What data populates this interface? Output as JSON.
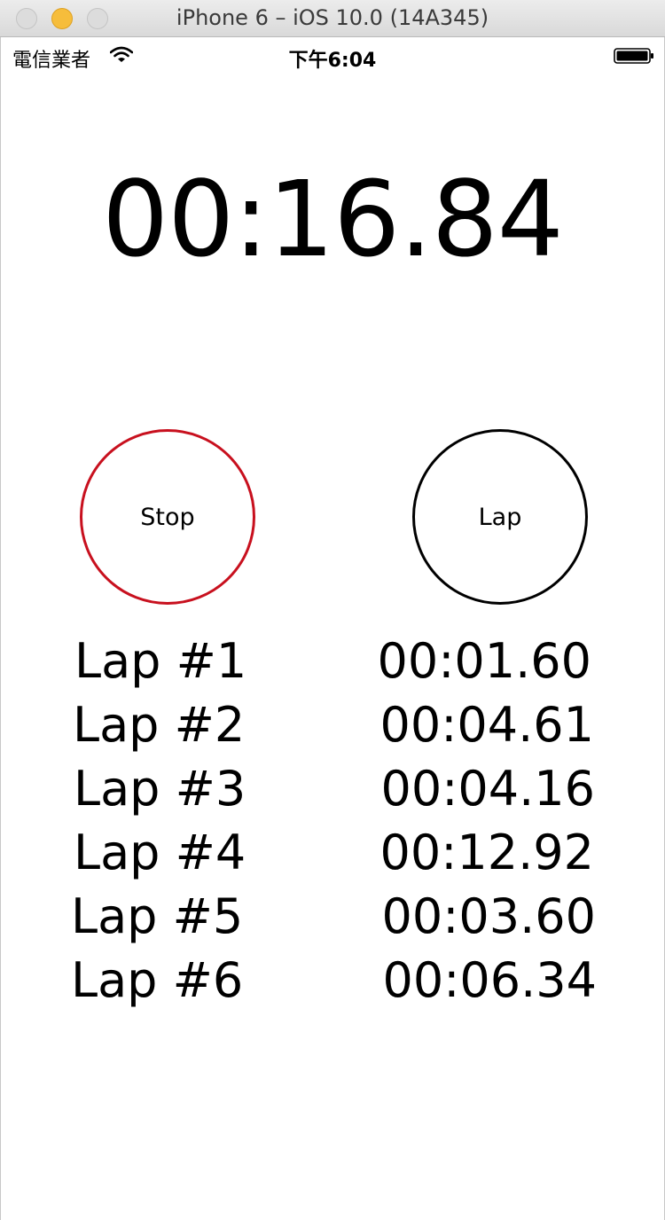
{
  "window": {
    "title": "iPhone 6 – iOS 10.0 (14A345)"
  },
  "statusbar": {
    "carrier": "電信業者",
    "time": "下午6:04",
    "wifi_icon": "wifi-icon",
    "battery_icon": "battery-icon"
  },
  "timer": {
    "display": "00:16.84"
  },
  "buttons": {
    "stop_label": "Stop",
    "stop_color": "#c8101e",
    "lap_label": "Lap",
    "lap_color": "#000000"
  },
  "laps": [
    {
      "label": "Lap #1",
      "time": "00:01.60"
    },
    {
      "label": "Lap #2",
      "time": "00:04.61"
    },
    {
      "label": "Lap #3",
      "time": "00:04.16"
    },
    {
      "label": "Lap #4",
      "time": "00:12.92"
    },
    {
      "label": "Lap #5",
      "time": "00:03.60"
    },
    {
      "label": "Lap #6",
      "time": "00:06.34"
    }
  ]
}
